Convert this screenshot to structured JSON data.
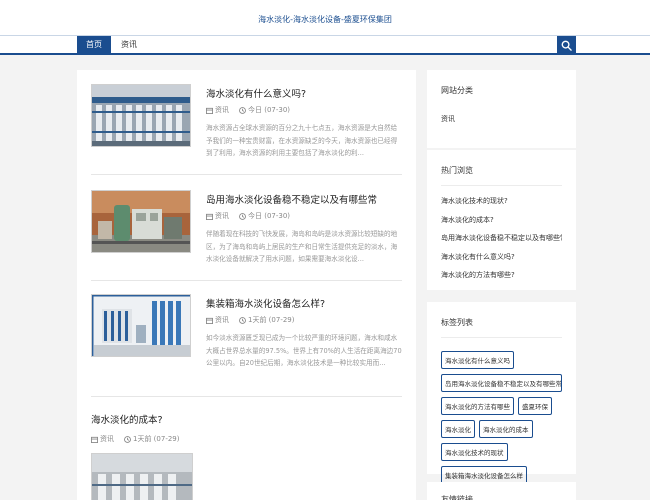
{
  "site": {
    "title": "海水淡化-海水淡化设备-盛夏环保集团"
  },
  "nav": {
    "items": [
      "首页",
      "资讯"
    ]
  },
  "icons": {
    "search": "search-icon",
    "category": "folder-icon",
    "date": "clock-icon"
  },
  "colors": {
    "brand": "#1a4d8f",
    "background": "#f3f3f3",
    "tag_border": "#1a4d8f"
  },
  "posts": [
    {
      "title": "海水淡化有什么意义吗?",
      "category": "资讯",
      "date": "今日 (07-30)",
      "excerpt": "海水资源占全球水资源的百分之九十七点五，海水资源是大自然给予我们的一种宝贵财富，在水资源缺乏的今天，海水资源也已经得到了利用，海水资源的利用主要包括了海水淡化的利..."
    },
    {
      "title": "岛用海水淡化设备稳不稳定以及有哪些常",
      "category": "资讯",
      "date": "今日 (07-30)",
      "excerpt": "伴随着现在科技的飞快发展，海岛和岛屿是淡水资源比较短缺的地区，为了海岛和岛屿上居民的生产和日常生活提供充足的淡水，海水淡化设备就解决了用水问题，如果需要海水淡化设..."
    },
    {
      "title": "集装箱海水淡化设备怎么样?",
      "category": "资讯",
      "date": "1天前 (07-29)",
      "excerpt": "如今淡水资源匮乏现已成为一个比较严重的环境问题，海水和咸水大概占世界总水量的97.5%。世界上有70%的人生活在距离海边70公里以内。自20世纪后期，海水淡化技术是一种比较实用而..."
    },
    {
      "title": "海水淡化的成本?",
      "category": "资讯",
      "date": "1天前 (07-29)"
    }
  ],
  "sidebar": {
    "categories": {
      "title": "网站分类",
      "items": [
        "资讯"
      ]
    },
    "hot": {
      "title": "热门浏览",
      "items": [
        "海水淡化技术的现状?",
        "海水淡化的成本?",
        "岛用海水淡化设备稳不稳定以及有哪些常",
        "海水淡化有什么意义吗?",
        "海水淡化的方法有哪些?"
      ]
    },
    "tags": {
      "title": "标签列表",
      "items": [
        "海水淡化有什么意义吗",
        "岛用海水淡化设备稳不稳定以及有哪些常",
        "海水淡化的方法有哪些",
        "盛夏环保",
        "海水淡化",
        "海水淡化的成本",
        "海水淡化技术的现状",
        "集装箱海水淡化设备怎么样"
      ]
    },
    "next": {
      "title": "友情链接"
    }
  }
}
